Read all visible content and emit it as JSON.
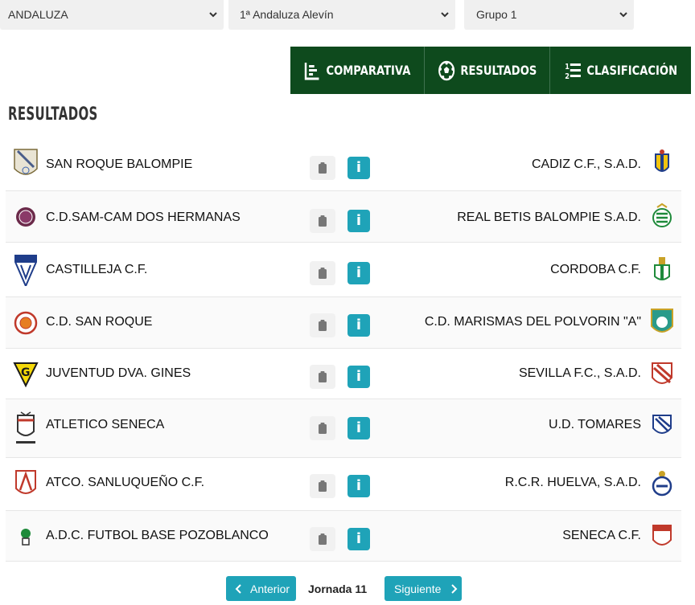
{
  "filters": {
    "region": "ANDALUZA",
    "competition": "1ª Andaluza Alevín",
    "group": "Grupo 1"
  },
  "nav": {
    "comparativa": "COMPARATIVA",
    "resultados": "RESULTADOS",
    "clasificacion": "CLASIFICACIÓN"
  },
  "section_title": "RESULTADOS",
  "matches": [
    {
      "home": "SAN ROQUE BALOMPIE",
      "away": "CADIZ C.F., S.A.D."
    },
    {
      "home": "C.D.SAM-CAM DOS HERMANAS",
      "away": "REAL BETIS BALOMPIE S.A.D."
    },
    {
      "home": "CASTILLEJA C.F.",
      "away": "CORDOBA C.F."
    },
    {
      "home": "C.D. SAN ROQUE",
      "away": "C.D. MARISMAS DEL POLVORIN \"A\""
    },
    {
      "home": "JUVENTUD DVA. GINES",
      "away": "SEVILLA F.C., S.A.D."
    },
    {
      "home": "ATLETICO SENECA",
      "away": "U.D. TOMARES"
    },
    {
      "home": "ATCO. SANLUQUEÑO C.F.",
      "away": "R.C.R. HUELVA, S.A.D."
    },
    {
      "home": "A.D.C. FUTBOL BASE POZOBLANCO",
      "away": "SENECA C.F."
    }
  ],
  "info_label": "i",
  "pager": {
    "prev": "Anterior",
    "current": "Jornada 11",
    "next": "Siguiente"
  },
  "colors": {
    "nav_bg": "#0e4a1d",
    "accent": "#1fa3b8"
  }
}
